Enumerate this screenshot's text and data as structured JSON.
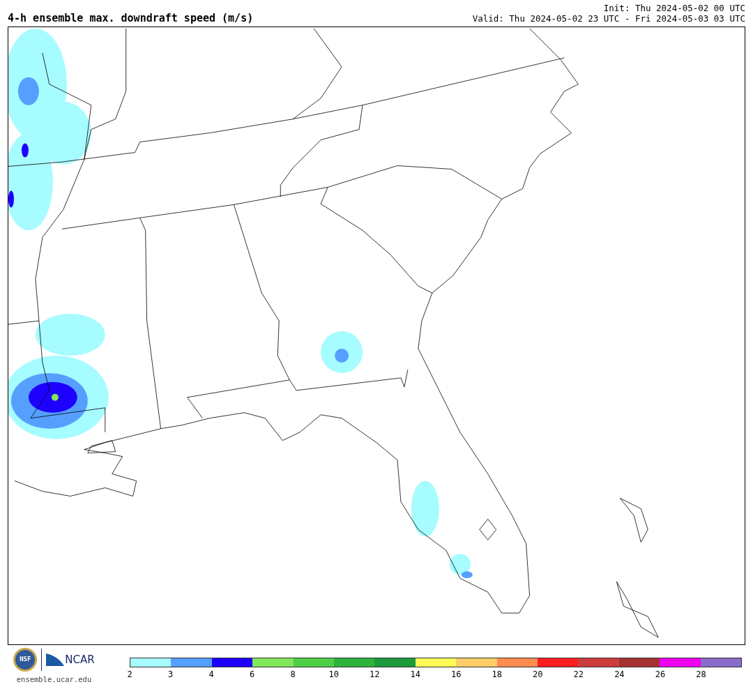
{
  "title": "4-h ensemble max. downdraft speed (m/s)",
  "init": "Init: Thu 2024-05-02 00 UTC",
  "valid": "Valid: Thu 2024-05-02 23 UTC - Fri 2024-05-03 03 UTC",
  "logos": {
    "nsf": "NSF",
    "ncar": "NCAR",
    "website": "ensemble.ucar.edu"
  },
  "colorbar": {
    "bins": [
      {
        "color": "#a6fcff",
        "label": "2"
      },
      {
        "color": "#55a0ff",
        "label": "3"
      },
      {
        "color": "#1e00ff",
        "label": "4"
      },
      {
        "color": "#80e65a",
        "label": "6"
      },
      {
        "color": "#50ce46",
        "label": "8"
      },
      {
        "color": "#2db33c",
        "label": "10"
      },
      {
        "color": "#1e9a3c",
        "label": "12"
      },
      {
        "color": "#fffc5a",
        "label": "14"
      },
      {
        "color": "#ffcd69",
        "label": "16"
      },
      {
        "color": "#ff8c50",
        "label": "18"
      },
      {
        "color": "#ff1e1e",
        "label": "20"
      },
      {
        "color": "#cd3c3c",
        "label": "22"
      },
      {
        "color": "#a53232",
        "label": "24"
      },
      {
        "color": "#ef00ef",
        "label": "26"
      },
      {
        "color": "#8a6ccc",
        "label": "28"
      }
    ]
  }
}
